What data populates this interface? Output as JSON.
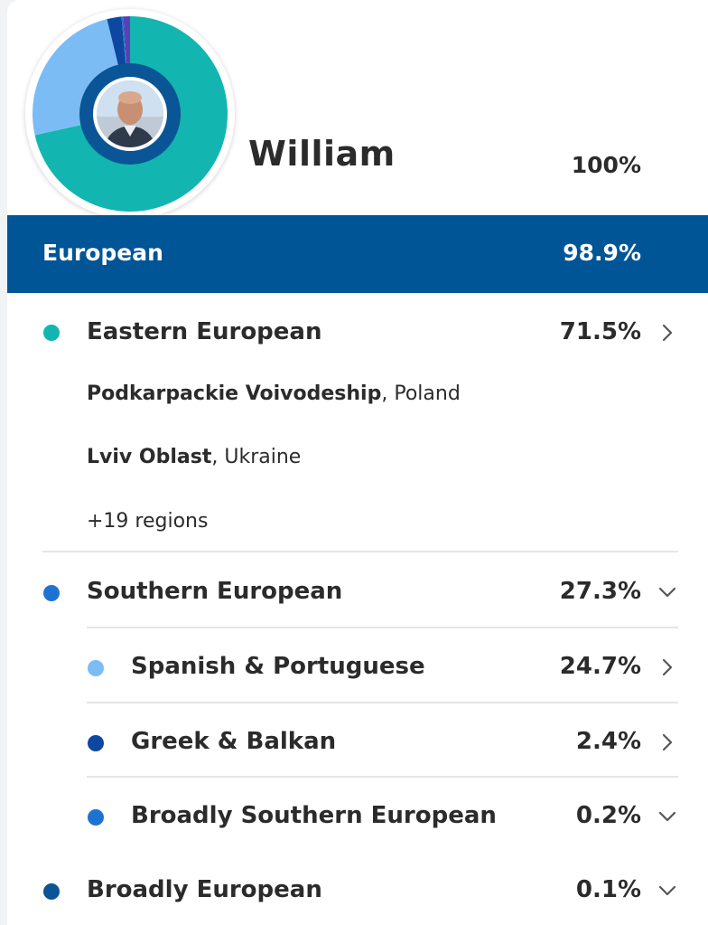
{
  "profile": {
    "name": "William",
    "total_pct": "100%"
  },
  "donut": {
    "segments": [
      {
        "label": "Eastern European",
        "value": 71.5,
        "color": "#13b5b1"
      },
      {
        "label": "Spanish & Portuguese",
        "value": 24.7,
        "color": "#7bbcf5"
      },
      {
        "label": "Greek & Balkan",
        "value": 2.4,
        "color": "#0d47a1"
      },
      {
        "label": "Broadly Southern European",
        "value": 0.2,
        "color": "#1e73d2"
      },
      {
        "label": "Broadly European",
        "value": 0.1,
        "color": "#0a5596"
      },
      {
        "label": "Other",
        "value": 1.1,
        "color": "#5b3fb6"
      }
    ],
    "ring_color": "#0a5596"
  },
  "header_band": {
    "label": "European",
    "pct": "98.9%",
    "color": "#005596"
  },
  "main": {
    "eastern": {
      "label": "Eastern European",
      "pct": "71.5%",
      "dot_color": "#13b5b1",
      "chevron": "chevron-right-icon",
      "regions": [
        {
          "name": "Podkarpackie Voivodeship",
          "country": ", Poland"
        },
        {
          "name": "Lviv Oblast",
          "country": ", Ukraine"
        }
      ],
      "more_regions": "+19 regions"
    },
    "southern": {
      "label": "Southern European",
      "pct": "27.3%",
      "dot_color": "#1e73d2",
      "chevron": "chevron-down-icon"
    },
    "sub_spanish": {
      "label": "Spanish & Portuguese",
      "pct": "24.7%",
      "dot_color": "#7bbcf5",
      "chevron": "chevron-right-icon"
    },
    "sub_greek": {
      "label": "Greek & Balkan",
      "pct": "2.4%",
      "dot_color": "#0d47a1",
      "chevron": "chevron-right-icon"
    },
    "sub_broad_southern": {
      "label": "Broadly Southern European",
      "pct": "0.2%",
      "dot_color": "#1e73d2",
      "chevron": "chevron-down-icon"
    },
    "broad_european": {
      "label": "Broadly European",
      "pct": "0.1%",
      "dot_color": "#0a5596",
      "chevron": "chevron-down-icon"
    }
  }
}
